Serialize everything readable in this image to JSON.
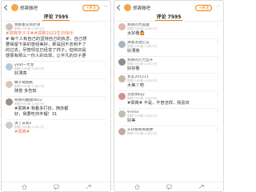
{
  "app": {
    "user_name": "郑爽微吧",
    "follow_label": "+关注",
    "more_glyph": "···"
  },
  "left": {
    "tab_label": "评论 7595",
    "post": {
      "name": "我那素衣郑赤清",
      "time": "刚刚7595楼·11月07日",
      "l1": "#郑爽辛子子#",
      "l1b": "#郑爽1022生日快乐",
      "l2": "# 每个人有自己的坚持自己的执念，自己想",
      "l3": "要保留下来的曾经美好，那是回不去到不了",
      "l4": "的过去，尽管现在已经变了样子，但依旧是",
      "l5": "感恩有那么一份人的出现，让平凡的日子更"
    },
    "comments": [
      {
        "name": "yeah~大宝",
        "time": "刚刚7595楼·11月07日",
        "text": "好漂亮"
      },
      {
        "name": "橘子褪留眠",
        "time": "刚刚7595楼·11月07日",
        "text": "随意 多告知"
      },
      {
        "name": "郑爽的腿腿0822",
        "time": "刚刚7595楼·11月07日",
        "text": "#郑爽#  我看多打扮，随赤都",
        "text2": "好，我要吃你丰榴！31"
      },
      {
        "name": "演了去闹2",
        "time": "刚刚7595楼·11月07日",
        "text": "#郑爽#"
      }
    ]
  },
  "right": {
    "tab_label": "评论 7595",
    "comments": [
      {
        "name": "郑爽的大狐狸",
        "time": "刚刚7595楼·11月07日",
        "text": "太好看🤷"
      },
      {
        "name": "清歌淡酒忆记",
        "time": "刚刚7595楼·11月07日",
        "text": "好漂亮"
      },
      {
        "name": "郑爽的火力全开",
        "time": "刚刚7595楼·11月07日",
        "text": "好好看"
      },
      {
        "name": "女友201211",
        "time": "刚刚7595楼·11月07日",
        "text": "大美丫吧"
      },
      {
        "name": "流星雨kyy",
        "time": "刚刚7595楼·11月07日",
        "text": "#郑爽#  不是，不管怎样，我喜欢"
      },
      {
        "name": "97lina",
        "time": "刚刚7595楼·11月07日",
        "text": "好美"
      },
      {
        "name": "天热看郑爽随便",
        "time": "刚刚7595楼·11月07日",
        "text": ""
      }
    ]
  },
  "colors": {
    "accent": "#f08200",
    "tag": "#eb7350"
  },
  "icons": [
    "chevron-left-icon",
    "more-icon",
    "like-icon",
    "home-icon",
    "message-icon",
    "share-icon"
  ]
}
